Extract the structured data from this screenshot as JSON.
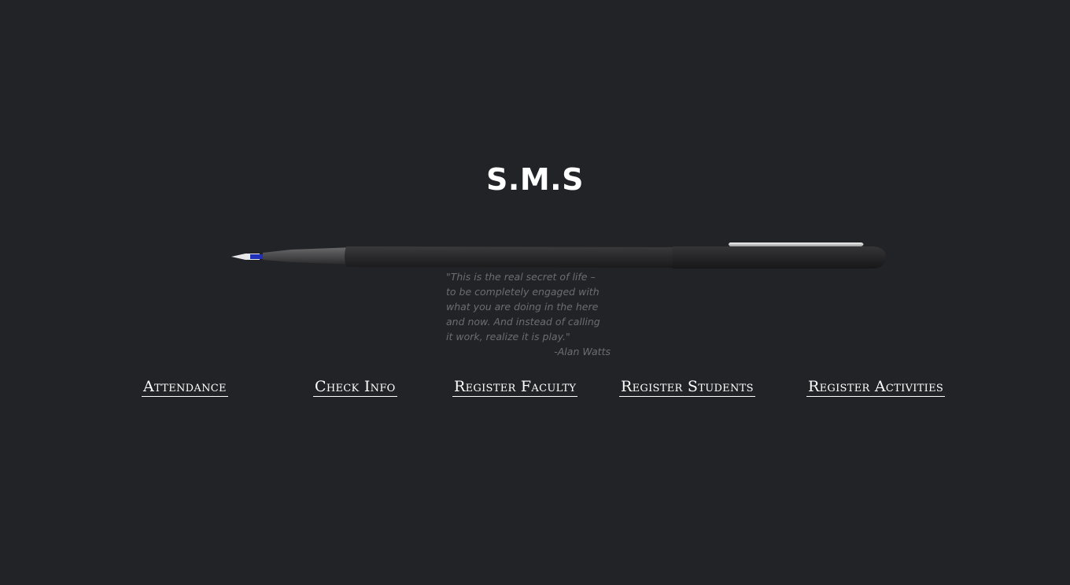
{
  "header": {
    "title": "S.M.S"
  },
  "quote": {
    "text": "\"This is the real secret of life –\nto be completely engaged with\nwhat you are doing in the here\nand now. And instead of calling\nit work, realize it is play.\"",
    "author": "-Alan Watts"
  },
  "nav": {
    "items": [
      {
        "label": "Attendance "
      },
      {
        "label": "Check Info"
      },
      {
        "label": "Register Faculty"
      },
      {
        "label": "Register Students"
      },
      {
        "label": "Register Activities"
      }
    ]
  },
  "colors": {
    "background": "#222327",
    "title": "#ffffff",
    "quote": "#6c6d71",
    "links": "#ffffff",
    "pen_body": "#2a2a2c",
    "pen_nib_accent": "#1f2fb8"
  },
  "icons": {
    "pen": "fountain-pen-icon"
  }
}
